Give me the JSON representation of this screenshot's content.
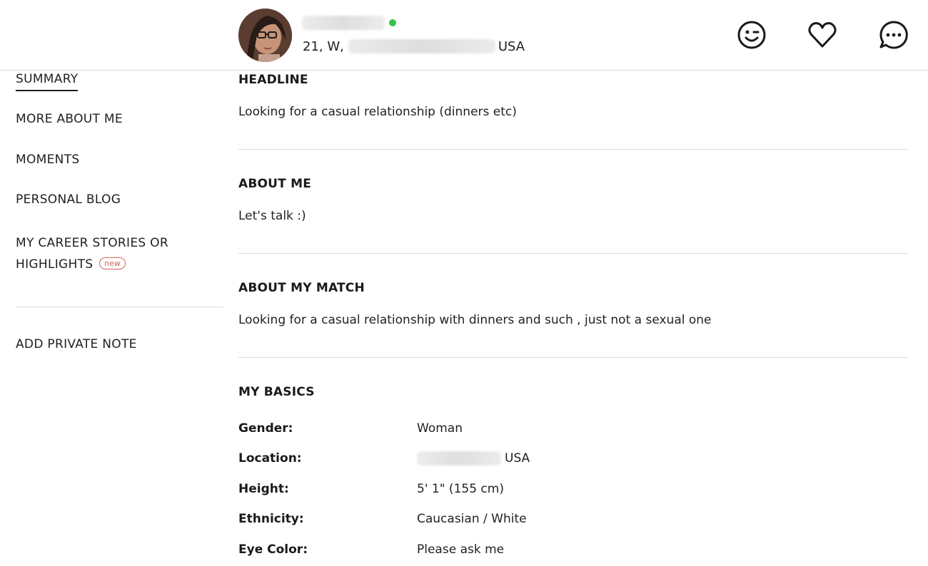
{
  "profile": {
    "age_gender": "21, W,",
    "country": "USA"
  },
  "actions": {
    "wink": "wink-icon",
    "like": "heart-icon",
    "message": "chat-icon"
  },
  "colors": {
    "online": "#33c24d",
    "new_badge": "#d2645a"
  },
  "sidebar": {
    "items": [
      {
        "label": "SUMMARY"
      },
      {
        "label": "MORE ABOUT ME"
      },
      {
        "label": "MOMENTS"
      },
      {
        "label": "PERSONAL BLOG"
      },
      {
        "label": "MY CAREER STORIES OR HIGHLIGHTS"
      }
    ],
    "new_badge": "new",
    "private_note": "ADD PRIVATE NOTE"
  },
  "sections": {
    "headline": {
      "title": "HEADLINE",
      "text": "Looking for a casual relationship (dinners etc)"
    },
    "about_me": {
      "title": "ABOUT ME",
      "text": "Let's talk :)"
    },
    "about_match": {
      "title": "ABOUT MY MATCH",
      "text": "Looking for a casual relationship with dinners and such , just not a sexual one"
    },
    "basics": {
      "title": "MY BASICS",
      "rows": [
        {
          "label": "Gender:",
          "value": "Woman"
        },
        {
          "label": "Location:",
          "value": "USA"
        },
        {
          "label": "Height:",
          "value": "5' 1\" (155 cm)"
        },
        {
          "label": "Ethnicity:",
          "value": "Caucasian / White"
        },
        {
          "label": "Eye Color:",
          "value": "Please ask me"
        }
      ]
    }
  }
}
